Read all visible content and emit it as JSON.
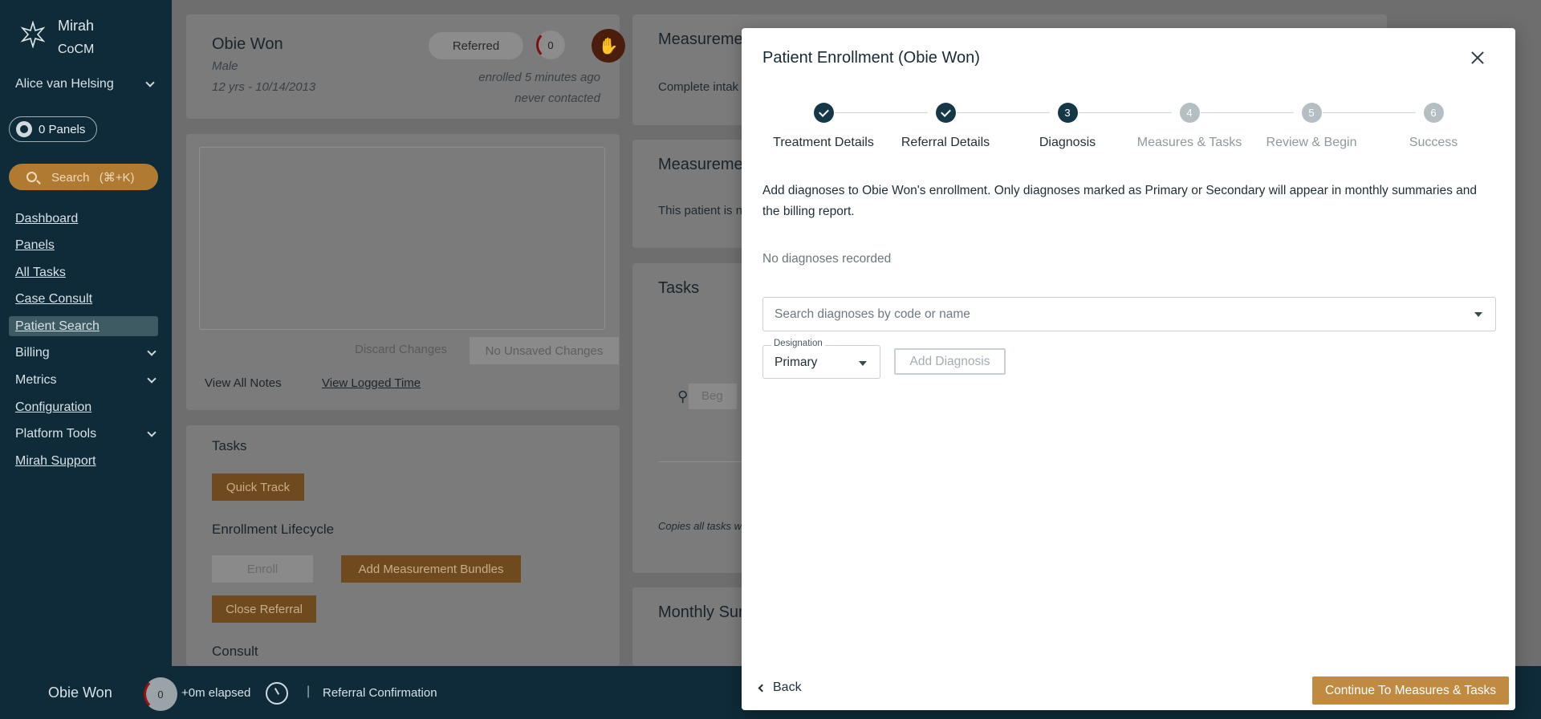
{
  "app": {
    "brand_name": "Mirah",
    "brand_sub": "CoCM",
    "user_name": "Alice van Helsing",
    "panels_label": "0 Panels",
    "search_label": "Search",
    "search_shortcut": "(⌘+K)"
  },
  "sidebar": {
    "items": [
      {
        "label": "Dashboard"
      },
      {
        "label": "Panels"
      },
      {
        "label": "All Tasks"
      },
      {
        "label": "Case Consult"
      },
      {
        "label": "Patient Search"
      },
      {
        "label": "Billing"
      },
      {
        "label": "Metrics"
      },
      {
        "label": "Configuration"
      },
      {
        "label": "Platform Tools"
      },
      {
        "label": "Mirah Support"
      }
    ]
  },
  "patient": {
    "name": "Obie Won",
    "gender": "Male",
    "age_dob": "12 yrs - 10/14/2013",
    "status": "Referred",
    "score": "0",
    "enrolled": "enrolled 5 minutes ago",
    "contacted": "never contacted"
  },
  "notes": {
    "discard_label": "Discard Changes",
    "saved_label": "No Unsaved Changes",
    "view_all_notes": "View All Notes",
    "view_logged_time": "View Logged Time"
  },
  "tasks_panel": {
    "title": "Tasks",
    "quick_track": "Quick Track",
    "lifecycle_title": "Enrollment Lifecycle",
    "enroll": "Enroll",
    "add_bundles": "Add Measurement Bundles",
    "close_referral": "Close Referral",
    "consult_title": "Consult"
  },
  "right_cards": {
    "measure1_title": "Measurements",
    "measure1_text": "Complete intak",
    "measure2_title": "Measurements",
    "measure2_text": "This patient is n",
    "tasks_title": "Tasks",
    "tasks_search": "Beg",
    "copies_text": "Copies all tasks w",
    "monthly_title": "Monthly Sum"
  },
  "bottom_bar": {
    "patient_name": "Obie Won",
    "score": "0",
    "elapsed": "+0m elapsed",
    "separator": "|",
    "referral": "Referral Confirmation"
  },
  "modal": {
    "title": "Patient Enrollment (Obie Won)",
    "steps": [
      {
        "num": "1",
        "label": "Treatment Details",
        "state": "done"
      },
      {
        "num": "2",
        "label": "Referral Details",
        "state": "done"
      },
      {
        "num": "3",
        "label": "Diagnosis",
        "state": "active"
      },
      {
        "num": "4",
        "label": "Measures & Tasks",
        "state": "future"
      },
      {
        "num": "5",
        "label": "Review & Begin",
        "state": "future"
      },
      {
        "num": "6",
        "label": "Success",
        "state": "future"
      }
    ],
    "intro": "Add diagnoses to Obie Won's enrollment. Only diagnoses marked as Primary or Secondary will appear in monthly summaries and the billing report.",
    "no_diagnoses": "No diagnoses recorded",
    "search_placeholder": "Search diagnoses by code or name",
    "designation_label": "Designation",
    "designation_value": "Primary",
    "add_diagnosis": "Add Diagnosis",
    "back": "Back",
    "continue": "Continue To Measures & Tasks"
  }
}
